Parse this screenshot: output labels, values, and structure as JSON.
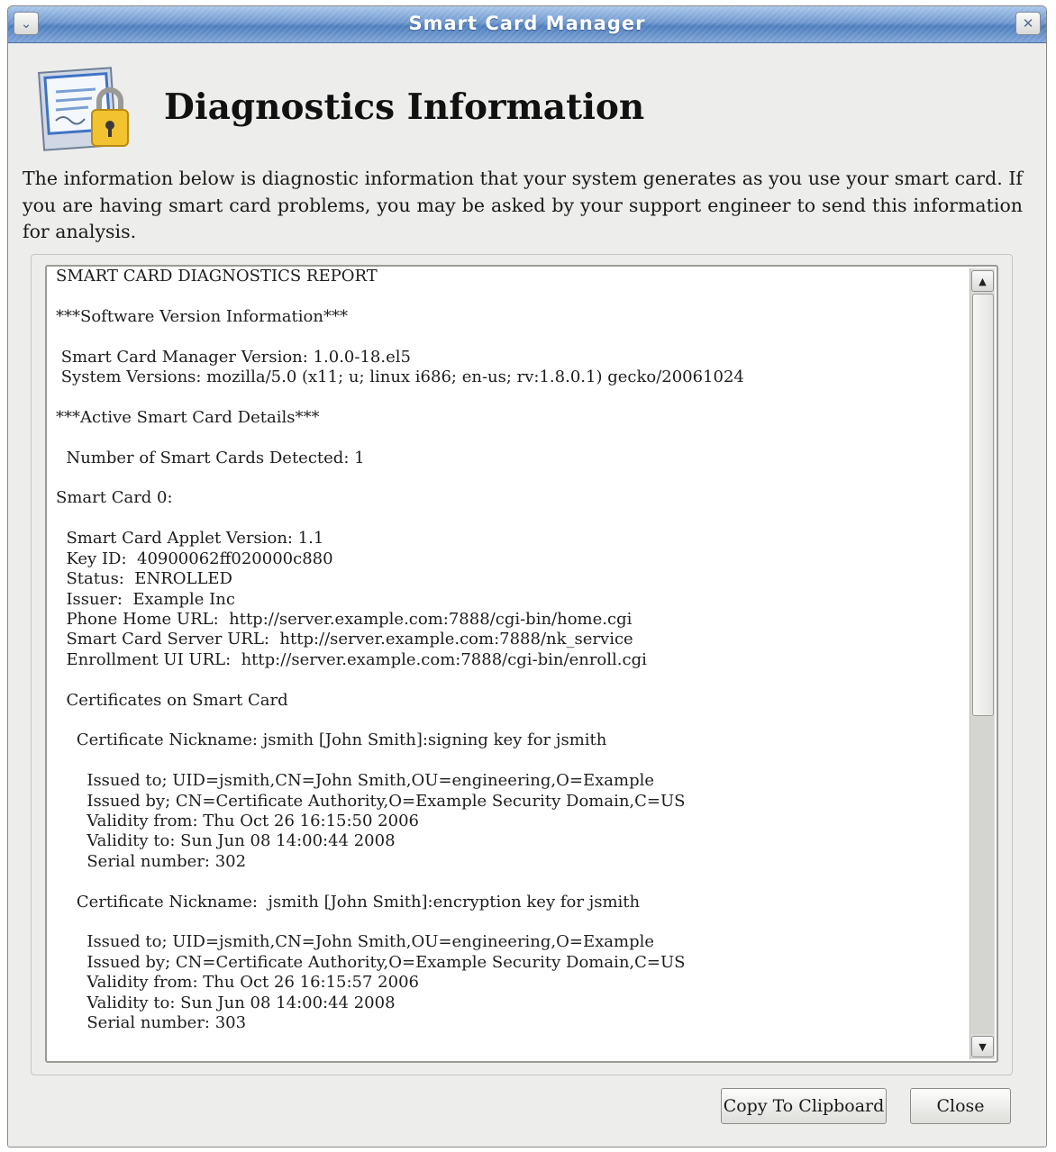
{
  "window": {
    "title": "Smart Card Manager",
    "menu_glyph": "⌄",
    "close_glyph": "✕"
  },
  "header": {
    "title": "Diagnostics Information",
    "icon": "certificate-lock-icon"
  },
  "description": "The information below is diagnostic information that your system generates as you use your smart card. If you are having smart card problems, you may be asked by your support engineer to send this information for analysis.",
  "report": {
    "lines": [
      "SMART CARD DIAGNOSTICS REPORT",
      "",
      "***Software Version Information***",
      "",
      " Smart Card Manager Version: 1.0.0-18.el5",
      " System Versions: mozilla/5.0 (x11; u; linux i686; en-us; rv:1.8.0.1) gecko/20061024",
      "",
      "***Active Smart Card Details***",
      "",
      "  Number of Smart Cards Detected: 1",
      "",
      "Smart Card 0:",
      "",
      "  Smart Card Applet Version: 1.1",
      "  Key ID:  40900062ff020000c880",
      "  Status:  ENROLLED",
      "  Issuer:  Example Inc",
      "  Phone Home URL:  http://server.example.com:7888/cgi-bin/home.cgi",
      "  Smart Card Server URL:  http://server.example.com:7888/nk_service",
      "  Enrollment UI URL:  http://server.example.com:7888/cgi-bin/enroll.cgi",
      "",
      "  Certificates on Smart Card",
      "",
      "    Certificate Nickname: jsmith [John Smith]:signing key for jsmith",
      "",
      "      Issued to; UID=jsmith,CN=John Smith,OU=engineering,O=Example",
      "      Issued by; CN=Certificate Authority,O=Example Security Domain,C=US",
      "      Validity from: Thu Oct 26 16:15:50 2006",
      "      Validity to: Sun Jun 08 14:00:44 2008",
      "      Serial number: 302",
      "",
      "    Certificate Nickname:  jsmith [John Smith]:encryption key for jsmith",
      "",
      "      Issued to; UID=jsmith,CN=John Smith,OU=engineering,O=Example",
      "      Issued by; CN=Certificate Authority,O=Example Security Domain,C=US",
      "      Validity from: Thu Oct 26 16:15:57 2006",
      "      Validity to: Sun Jun 08 14:00:44 2008",
      "      Serial number: 303"
    ],
    "scroll_position": 0,
    "visible_fraction": 0.57
  },
  "buttons": {
    "copy_label": "Copy To Clipboard",
    "close_label": "Close"
  }
}
